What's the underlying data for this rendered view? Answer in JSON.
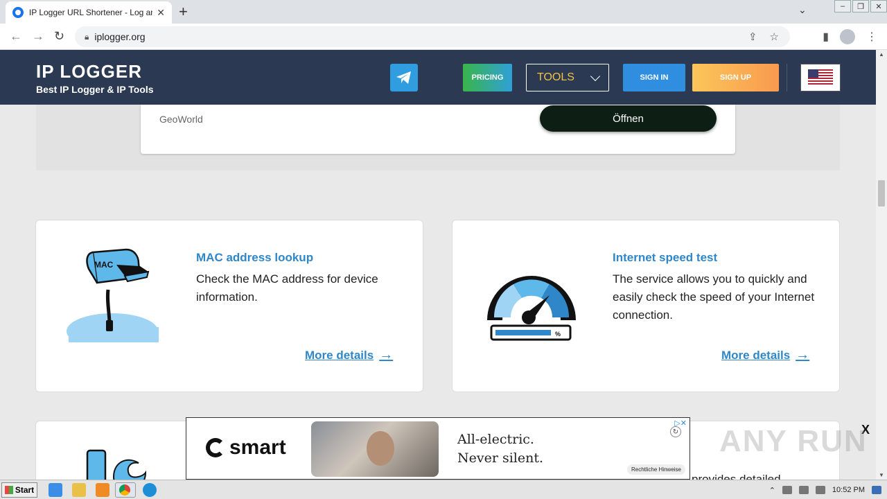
{
  "browser": {
    "tab_title": "IP Logger URL Shortener - Log and T",
    "tab_close": "✕",
    "new_tab": "+",
    "url": "iplogger.org"
  },
  "header": {
    "brand": "IP LOGGER",
    "tagline": "Best IP Logger & IP Tools",
    "pricing": "PRICING",
    "tools": "TOOLS",
    "signin": "SIGN IN",
    "signup": "SIGN UP",
    "accent": "#2b3a52"
  },
  "top_ad": {
    "advertiser": "GeoWorld",
    "cta": "Öffnen"
  },
  "cards": [
    {
      "title": "MAC address lookup",
      "description": "Check the MAC address for device information.",
      "link": "More details",
      "icon": "mailbox-icon"
    },
    {
      "title": "Internet speed test",
      "description": "The service allows you to quickly and easily check the speed of your Internet connection.",
      "link": "More details",
      "icon": "speedometer-icon"
    }
  ],
  "third_card": {
    "partial_text": "provides detailed"
  },
  "bottom_ad": {
    "brand": "smart",
    "slogan_line1": "All-electric.",
    "slogan_line2": "Never silent.",
    "legal": "Rechtliche Hinweise"
  },
  "overlay": {
    "close": "X",
    "watermark": "ANY RUN"
  },
  "taskbar": {
    "start": "Start",
    "time": "10:52 PM"
  }
}
